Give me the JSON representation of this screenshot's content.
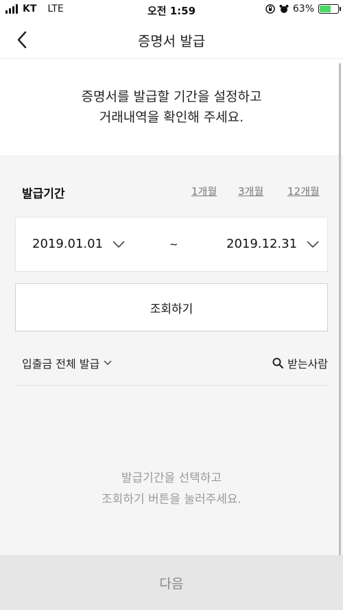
{
  "status_bar": {
    "carrier": "KT",
    "network": "LTE",
    "time": "오전 1:59",
    "battery_percent": "63%",
    "battery_level": 0.63,
    "accent_battery": "#4cd964"
  },
  "header": {
    "title": "증명서 발급",
    "back_icon": "chevron-left-icon"
  },
  "intro": {
    "line1": "증명서를 발급할 기간을 설정하고",
    "line2": "거래내역을 확인해 주세요."
  },
  "period": {
    "label": "발급기간",
    "quick_options": [
      "1개월",
      "3개월",
      "12개월"
    ],
    "start_date": "2019.01.01",
    "separator": "~",
    "end_date": "2019.12.31"
  },
  "search_button": "조회하기",
  "filter": {
    "label": "입출금 전체 발급",
    "recipient_label": "받는사람"
  },
  "empty_state": {
    "line1": "발급기간을 선택하고",
    "line2": "조회하기 버튼을 눌러주세요."
  },
  "next_button": "다음"
}
